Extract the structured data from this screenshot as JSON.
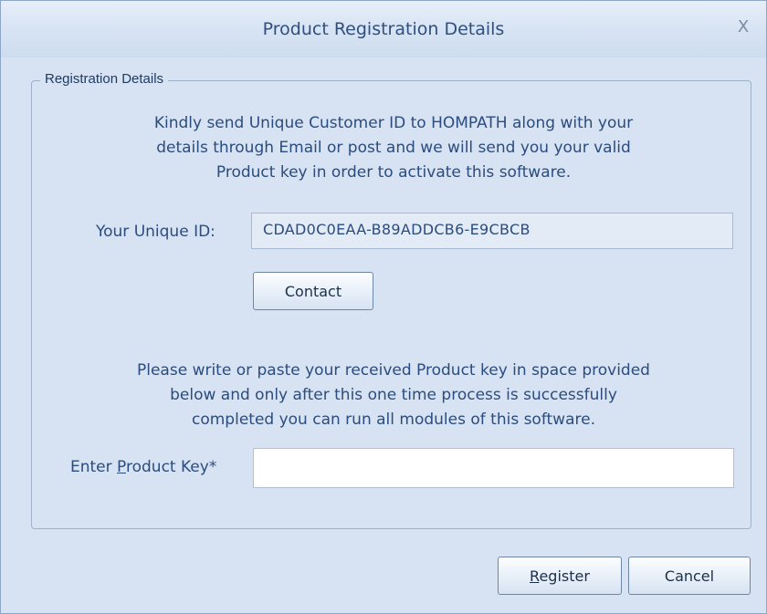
{
  "window": {
    "title": "Product Registration Details",
    "close_glyph": "X"
  },
  "group": {
    "legend": "Registration Details"
  },
  "intro": {
    "line1": "Kindly send Unique Customer ID to HOMPATH along with your",
    "line2": "details through Email or post and we will send you your valid",
    "line3": "Product key in order to activate this software."
  },
  "unique_id": {
    "label": "Your Unique ID:",
    "value": "CDAD0C0EAA-B89ADDCB6-E9CBCB"
  },
  "contact_button": {
    "label": "Contact"
  },
  "instructions": {
    "line1": "Please write or paste your received Product key in space provided",
    "line2": "below and only after this one time process is successfully",
    "line3": "completed you can run all modules of this software."
  },
  "product_key": {
    "label_prefix": "Enter ",
    "label_mnemonic": "P",
    "label_rest": "roduct Key*",
    "value": "",
    "placeholder": ""
  },
  "buttons": {
    "register_mnemonic": "R",
    "register_rest": "egister",
    "cancel": "Cancel"
  },
  "colors": {
    "background": "#d7e3f2",
    "text": "#2b4c7e",
    "title_text": "#2e4f7f"
  }
}
